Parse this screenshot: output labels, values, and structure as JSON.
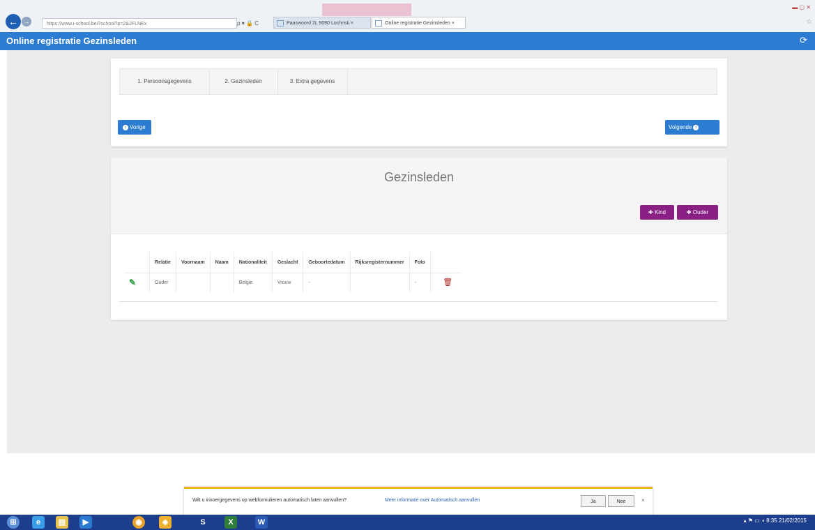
{
  "browser": {
    "url": "https://www.i-school.be/?school?p=2&2FLNEx",
    "tabs": [
      {
        "label": "Paaswoord 2L 9080 Lochristi ×"
      },
      {
        "label": "Online registratie Gezinsleden ×"
      }
    ],
    "addr_tools": "ρ ▾ 🔒 C"
  },
  "app": {
    "title": "Online registratie Gezinsleden",
    "refresh_icon": "⟳"
  },
  "steps": [
    {
      "label": "1. Persoonsgegevens"
    },
    {
      "label": "2. Gezinsleden"
    },
    {
      "label": "3. Extra gegevens"
    }
  ],
  "buttons": {
    "prev": "Vorige",
    "next": "Volgende",
    "add_kind": "Kind",
    "add_ouder": "Ouder"
  },
  "section": {
    "title": "Gezinsleden"
  },
  "table": {
    "headers": [
      "",
      "Relatie",
      "Voornaam",
      "Naam",
      "Nationaliteit",
      "Geslacht",
      "Geboortedatum",
      "Rijksregisternummer",
      "Foto",
      ""
    ],
    "rows": [
      {
        "relatie": "Ouder",
        "voornaam": "",
        "naam": "",
        "nationaliteit": "Belgie",
        "geslacht": "Vrouw",
        "geboortedatum": "-",
        "rijksregisternummer": "",
        "foto": "-"
      }
    ]
  },
  "notification": {
    "text": "Wilt u invoergegevens op webformulieren automatisch laten aanvullen?",
    "link": "Meer informatie over Automatisch aanvullen",
    "yes": "Ja",
    "no": "Nee",
    "close": "×"
  },
  "taskbar": {
    "time": "8:35",
    "date": "21/02/2015"
  }
}
